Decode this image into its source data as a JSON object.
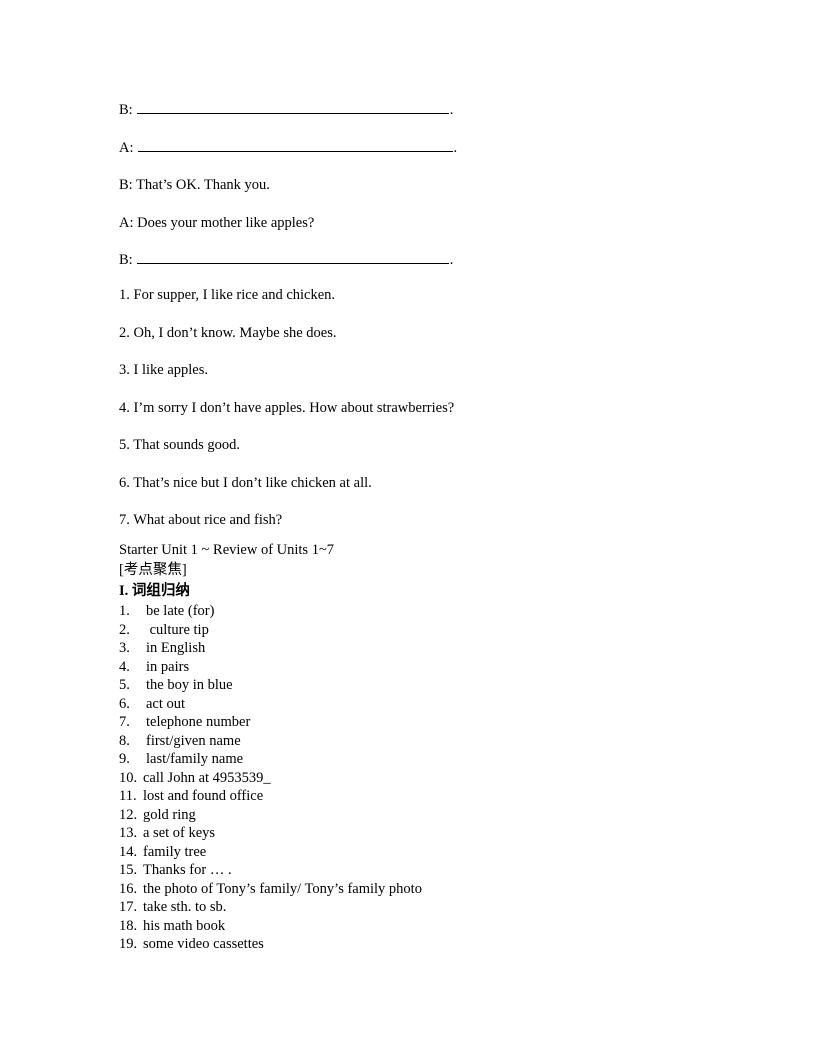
{
  "document": {
    "background_color": "#ffffff",
    "text_color": "#000000"
  },
  "dialogue": {
    "lines": [
      {
        "speaker": "B:",
        "kind": "blank",
        "answer": "",
        "trailing": "."
      },
      {
        "speaker": "A:",
        "kind": "blank",
        "answer": "",
        "trailing": "."
      },
      {
        "speaker": "B:",
        "kind": "text",
        "text": "That’s OK. Thank you."
      },
      {
        "speaker": "A:",
        "kind": "text",
        "text": "Does your mother like apples?"
      },
      {
        "speaker": "B:",
        "kind": "blank",
        "answer": "",
        "trailing": "."
      }
    ],
    "line_1": "B:",
    "line_2": "A:",
    "line_3": "B: That’s OK. Thank you.",
    "line_4": "A: Does your mother like apples?",
    "line_5": "B:"
  },
  "answer_sentences": {
    "items": [
      "1. For supper, I like rice and chicken.",
      "2. Oh, I don’t know. Maybe she does.",
      "3. I like apples.",
      "4. I’m sorry I don’t have apples. How about strawberries?",
      "5. That sounds good.",
      "6. That’s nice but I don’t like chicken at all.",
      "7. What about rice and fish?"
    ]
  },
  "review_section": {
    "unit_range_title": "Starter Unit 1 ~ Review of Units 1~7",
    "focus_bracket": "[考点聚焦]",
    "heading": "I. 词组归纳",
    "phrases": [
      {
        "num": "1.",
        "text": "be late (for)"
      },
      {
        "num": "2.",
        "text": " culture tip"
      },
      {
        "num": "3.",
        "text": "in English"
      },
      {
        "num": "4.",
        "text": "in pairs"
      },
      {
        "num": "5.",
        "text": "the boy in blue"
      },
      {
        "num": "6.",
        "text": "act out"
      },
      {
        "num": "7.",
        "text": "telephone number"
      },
      {
        "num": "8.",
        "text": "first/given name"
      },
      {
        "num": "9.",
        "text": "last/family name"
      },
      {
        "num": "10.",
        "text": "call John at 4953539_"
      },
      {
        "num": "11.",
        "text": "lost and found office"
      },
      {
        "num": "12.",
        "text": "gold ring"
      },
      {
        "num": "13.",
        "text": "a set of keys"
      },
      {
        "num": "14.",
        "text": "family tree"
      },
      {
        "num": "15.",
        "text": "Thanks for … ."
      },
      {
        "num": "16.",
        "text": "the photo of Tony’s family/ Tony’s family photo"
      },
      {
        "num": "17.",
        "text": "take sth. to sb."
      },
      {
        "num": "18.",
        "text": "his math book"
      },
      {
        "num": "19.",
        "text": "some video cassettes"
      }
    ]
  }
}
